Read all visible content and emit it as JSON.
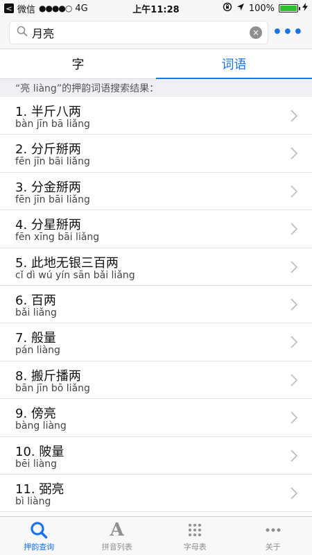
{
  "status": {
    "back_label": "<",
    "carrier": "微信",
    "signal": "●●●●○",
    "network": "4G",
    "time": "上午11:28",
    "battery_text": "100%",
    "battery_level": 1.0
  },
  "search": {
    "value": "月亮",
    "clear_label": "×",
    "more_label": "•••"
  },
  "tabs": [
    {
      "label": "字",
      "active": false
    },
    {
      "label": "词语",
      "active": true
    }
  ],
  "result_header": "“亮 liàng”的押韵词语搜索结果：",
  "results": [
    {
      "word": "1. 半斤八两",
      "pinyin": "bàn jīn bā liǎng"
    },
    {
      "word": "2. 分斤掰两",
      "pinyin": "fēn jīn bāi liǎng"
    },
    {
      "word": "3. 分金掰两",
      "pinyin": "fēn jīn bāi liǎng"
    },
    {
      "word": "4. 分星掰两",
      "pinyin": "fēn xīng bāi liǎng"
    },
    {
      "word": "5. 此地无银三百两",
      "pinyin": "cǐ dì wú yín sān bǎi liǎng"
    },
    {
      "word": "6. 百两",
      "pinyin": "bǎi liǎng"
    },
    {
      "word": "7. 般量",
      "pinyin": "pán liàng"
    },
    {
      "word": "8. 搬斤播两",
      "pinyin": "bān jīn bō liǎng"
    },
    {
      "word": "9. 傍亮",
      "pinyin": "bàng liàng"
    },
    {
      "word": "10. 陂量",
      "pinyin": "bēi liàng"
    },
    {
      "word": "11. 弼亮",
      "pinyin": "bì liàng"
    }
  ],
  "tabbar": [
    {
      "label": "押韵查询",
      "icon": "search-icon",
      "active": true
    },
    {
      "label": "拼音列表",
      "icon": "letter-a-icon",
      "active": false
    },
    {
      "label": "字母表",
      "icon": "grid-icon",
      "active": false
    },
    {
      "label": "关于",
      "icon": "more-icon",
      "active": false
    }
  ],
  "colors": {
    "accent": "#1a73e8",
    "inactive": "#8e8e93",
    "battery": "#2fc02f"
  }
}
